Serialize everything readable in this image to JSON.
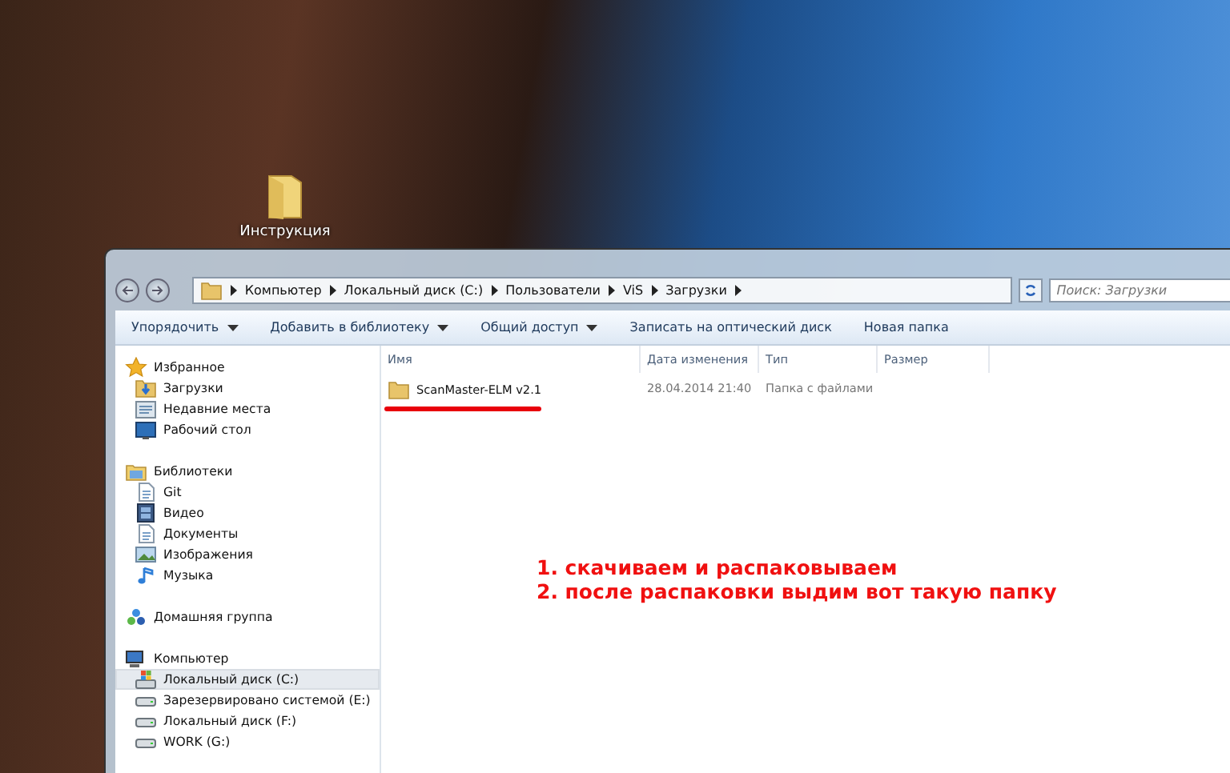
{
  "desktop": {
    "icons": [
      {
        "label": "Инструкция"
      }
    ]
  },
  "window": {
    "address_path": [
      "Компьютер",
      "Локальный диск (C:)",
      "Пользователи",
      "ViS",
      "Загрузки"
    ],
    "search": {
      "placeholder": "Поиск: Загрузки"
    },
    "toolbar": [
      {
        "label": "Упорядочить",
        "dropdown": true
      },
      {
        "label": "Добавить в библиотеку",
        "dropdown": true
      },
      {
        "label": "Общий доступ",
        "dropdown": true
      },
      {
        "label": "Записать на оптический диск",
        "dropdown": false
      },
      {
        "label": "Новая папка",
        "dropdown": false
      }
    ],
    "sidebar": [
      {
        "label": "Избранное",
        "kind": "star",
        "items": [
          {
            "label": "Загрузки",
            "kind": "downloads",
            "selected": false
          },
          {
            "label": "Недавние места",
            "kind": "recent",
            "selected": false
          },
          {
            "label": "Рабочий стол",
            "kind": "desktop",
            "selected": false
          }
        ]
      },
      {
        "label": "Библиотеки",
        "kind": "library",
        "items": [
          {
            "label": "Git",
            "kind": "document",
            "selected": false
          },
          {
            "label": "Видео",
            "kind": "video",
            "selected": false
          },
          {
            "label": "Документы",
            "kind": "document",
            "selected": false
          },
          {
            "label": "Изображения",
            "kind": "image",
            "selected": false
          },
          {
            "label": "Музыка",
            "kind": "music",
            "selected": false
          }
        ]
      },
      {
        "label": "Домашняя группа",
        "kind": "homegroup"
      },
      {
        "label": "Компьютер",
        "kind": "computer",
        "items": [
          {
            "label": "Локальный диск (C:)",
            "kind": "system-drive",
            "selected": true
          },
          {
            "label": "Зарезервировано системой (E:)",
            "kind": "drive",
            "selected": false
          },
          {
            "label": "Локальный диск (F:)",
            "kind": "drive",
            "selected": false
          },
          {
            "label": "WORK (G:)",
            "kind": "drive",
            "selected": false
          }
        ]
      }
    ],
    "columns": [
      "Имя",
      "Дата изменения",
      "Тип",
      "Размер"
    ],
    "rows": [
      {
        "name": "ScanMaster-ELM v2.1",
        "date": "28.04.2014 21:40",
        "type": "Папка с файлами",
        "underlined": true
      }
    ],
    "annotation": [
      "1. скачиваем и распаковываем",
      "2. после распаковки выдим вот такую папку"
    ]
  }
}
